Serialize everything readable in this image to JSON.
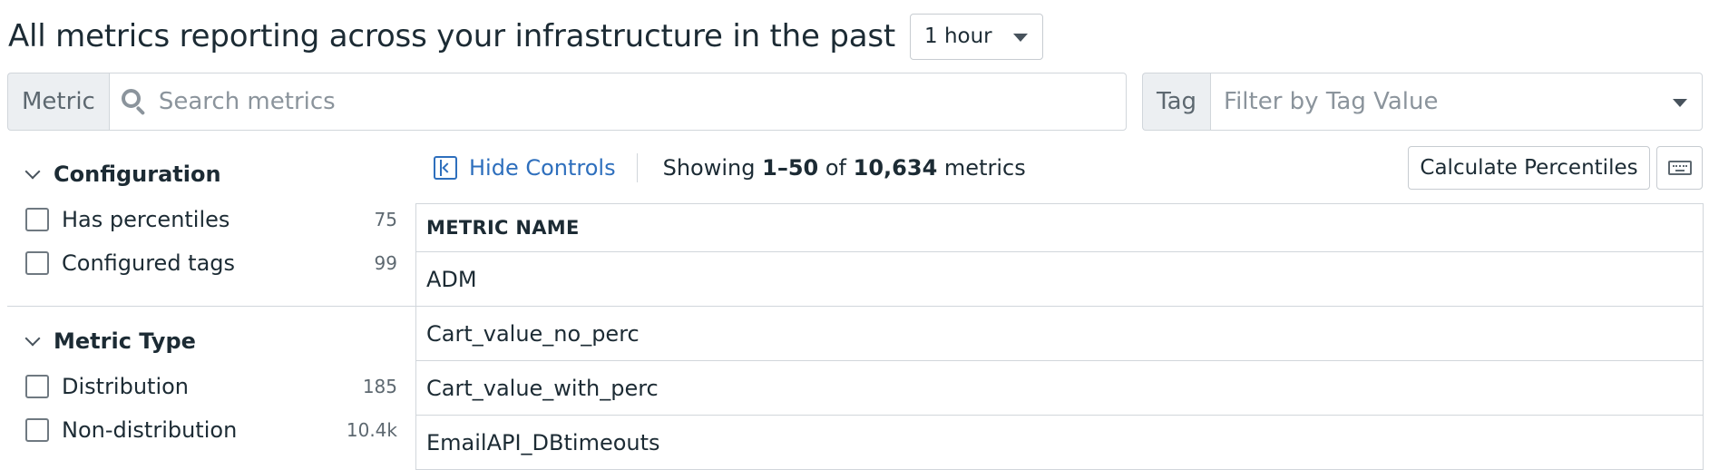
{
  "header": {
    "title": "All metrics reporting across your infrastructure in the past",
    "time_select_value": "1 hour"
  },
  "search": {
    "metric_label": "Metric",
    "metric_placeholder": "Search metrics",
    "tag_label": "Tag",
    "tag_placeholder": "Filter by Tag Value"
  },
  "sidebar": {
    "facets": [
      {
        "title": "Configuration",
        "items": [
          {
            "label": "Has percentiles",
            "count": "75"
          },
          {
            "label": "Configured tags",
            "count": "99"
          }
        ]
      },
      {
        "title": "Metric Type",
        "items": [
          {
            "label": "Distribution",
            "count": "185"
          },
          {
            "label": "Non-distribution",
            "count": "10.4k"
          }
        ]
      }
    ]
  },
  "controls": {
    "hide_label": "Hide Controls",
    "showing_prefix": "Showing",
    "range": "1–50",
    "of_word": "of",
    "total": "10,634",
    "suffix": "metrics",
    "calc_button": "Calculate Percentiles"
  },
  "table": {
    "column_header": "METRIC NAME",
    "rows": [
      "ADM",
      "Cart_value_no_perc",
      "Cart_value_with_perc",
      "EmailAPI_DBtimeouts"
    ]
  },
  "icons": {
    "search": "search-icon",
    "caret": "caret-down-icon",
    "chevron": "chevron-down-icon",
    "hide_controls": "collapse-panel-icon",
    "keyboard": "keyboard-icon"
  },
  "colors": {
    "link": "#2e6fbd",
    "text": "#1c2b34",
    "border": "#d1d6db",
    "addon_bg": "#eceff2"
  }
}
